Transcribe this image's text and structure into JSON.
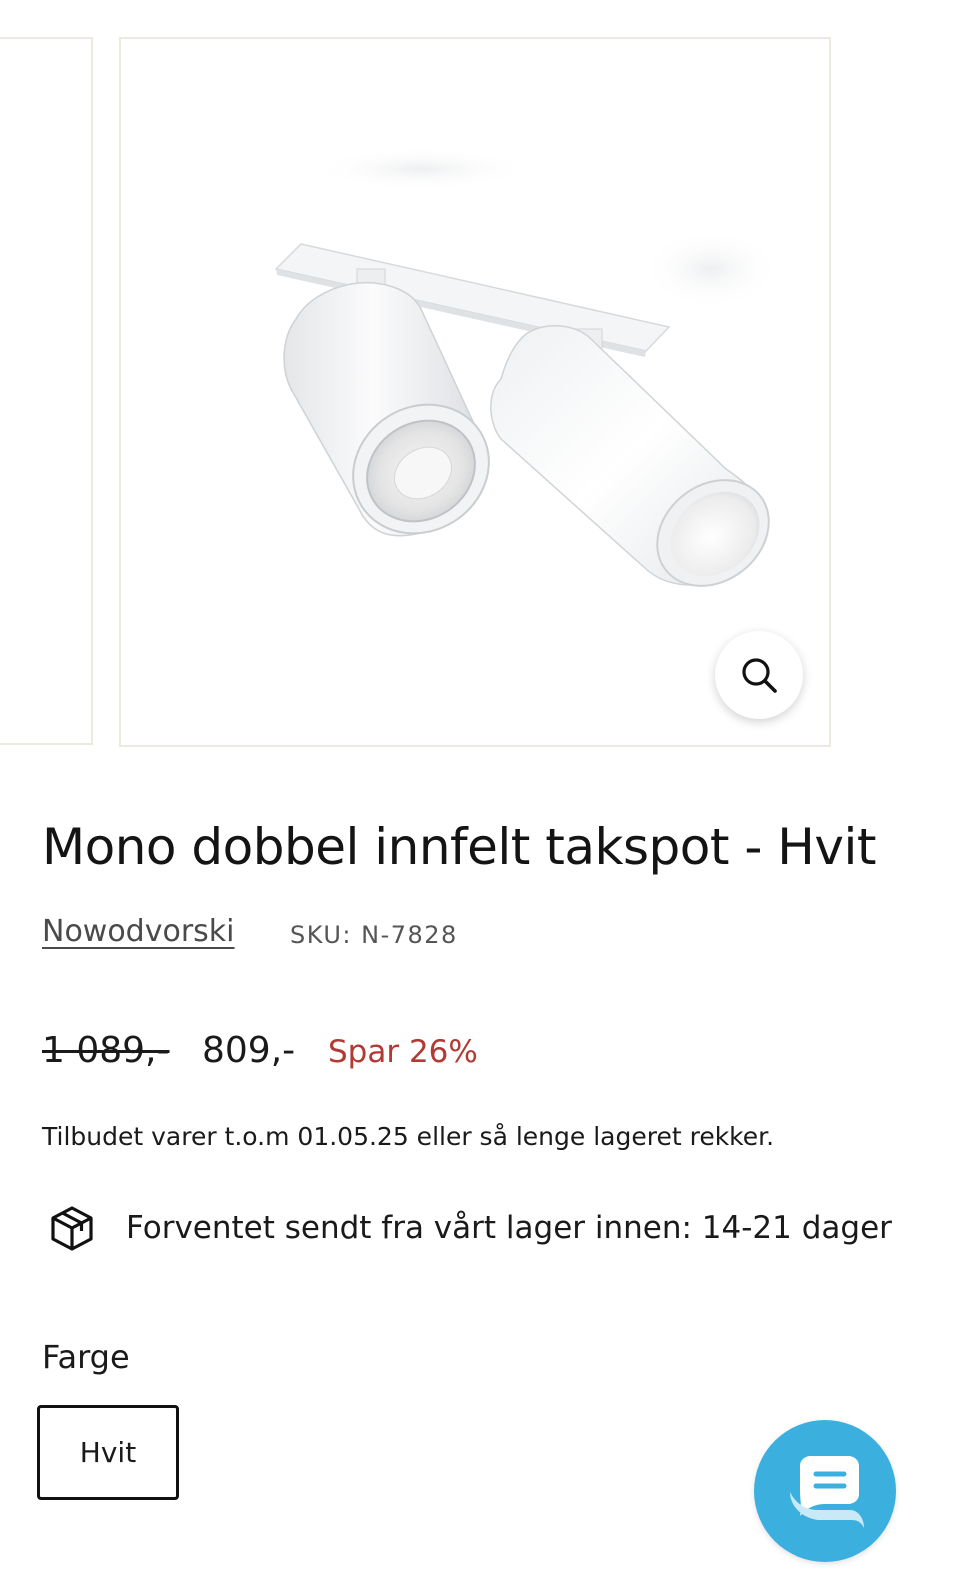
{
  "gallery": {
    "zoom_icon": "magnifier-icon",
    "image_subject": "white double recessed ceiling spotlight"
  },
  "product": {
    "title": "Mono dobbel innfelt takspot - Hvit",
    "brand": "Nowodvorski",
    "sku": "SKU: N-7828"
  },
  "pricing": {
    "old_price": "1 089,-",
    "new_price": "809,-",
    "discount": "Spar 26%",
    "offer_note": "Tilbudet varer t.o.m 01.05.25 eller så lenge lageret rekker."
  },
  "shipping": {
    "icon": "package-box-icon",
    "text": "Forventet sendt fra vårt lager innen: 14-21 dager"
  },
  "options": {
    "color_label": "Farge",
    "selected_color": "Hvit"
  },
  "chat": {
    "icon": "chat-bubble-icon"
  },
  "colors": {
    "discount": "#b23a35",
    "chat": "#3bb0df",
    "card_border": "#ece9e2"
  }
}
